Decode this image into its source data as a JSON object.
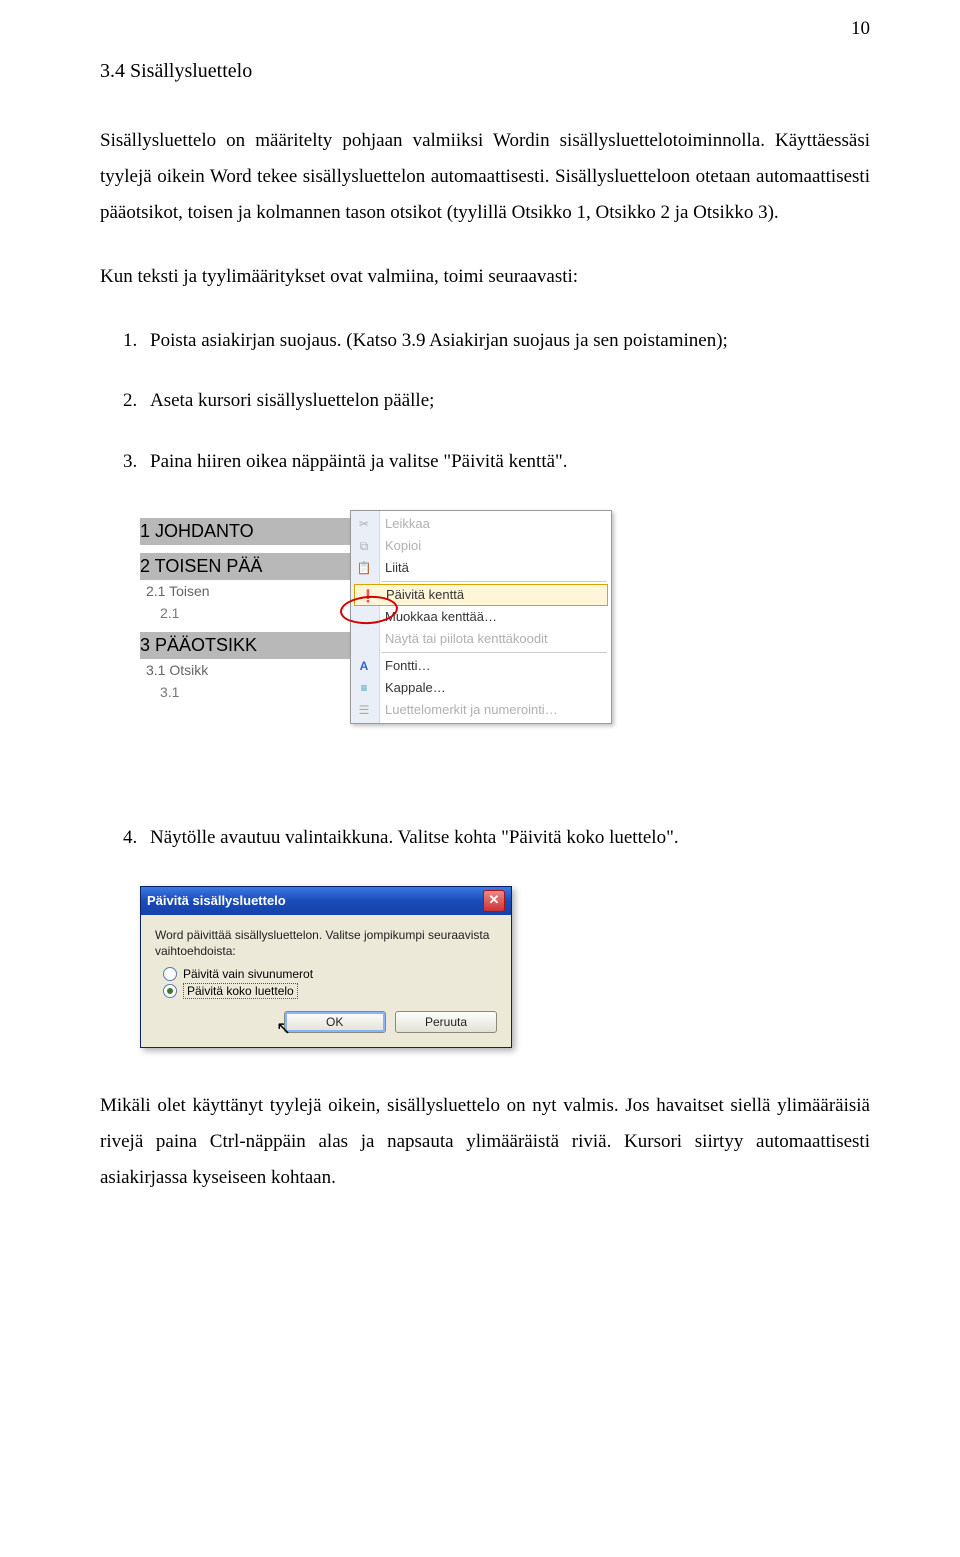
{
  "page_number": "10",
  "heading": "3.4  Sisällysluettelo",
  "para1": "Sisällysluettelo on määritelty pohjaan valmiiksi Wordin sisällysluettelotoiminnolla. Käyttäessäsi tyylejä oikein Word tekee sisällysluettelon automaattisesti. Sisällysluetteloon otetaan automaattisesti pääotsikot, toisen ja kolmannen tason otsikot (tyylillä Otsikko 1, Otsikko 2 ja Otsikko 3).",
  "para2": "Kun teksti ja tyylimääritykset ovat valmiina, toimi seuraavasti:",
  "steps": {
    "s1": "Poista asiakirjan suojaus. (Katso 3.9 Asiakirjan suojaus ja sen poistaminen);",
    "s2": "Aseta kursori sisällysluettelon päälle;",
    "s3": "Paina hiiren oikea näppäintä ja valitse \"Päivitä kenttä\".",
    "s4": "Näytölle avautuu valintaikkuna. Valitse kohta \"Päivitä koko luettelo\"."
  },
  "toc": {
    "r1": "1 JOHDANTO",
    "r2": "2 TOISEN PÄÄ",
    "r3": "2.1 Toisen",
    "r4": "2.1",
    "r5": "3 PÄÄOTSIKK",
    "r6": "3.1 Otsikk",
    "r7": "3.1"
  },
  "menu": {
    "cut": "Leikkaa",
    "copy": "Kopioi",
    "paste": "Liitä",
    "update": "Päivitä kenttä",
    "edit": "Muokkaa kenttää…",
    "toggle": "Näytä tai piilota kenttäkoodit",
    "font": "Fontti…",
    "para": "Kappale…",
    "bullets": "Luettelomerkit ja numerointi…"
  },
  "dialog": {
    "title": "Päivitä sisällysluettelo",
    "body1": "Word päivittää sisällysluettelon. Valitse jompikumpi seuraavista vaihtoehdoista:",
    "opt1": "Päivitä vain sivunumerot",
    "opt2": "Päivitä koko luettelo",
    "ok": "OK",
    "cancel": "Peruuta"
  },
  "para3": "Mikäli olet käyttänyt tyylejä oikein, sisällysluettelo on nyt valmis. Jos havaitset siellä ylimääräisiä rivejä paina Ctrl-näppäin alas ja napsauta ylimääräistä riviä. Kursori siirtyy automaattisesti asiakirjassa kyseiseen kohtaan."
}
